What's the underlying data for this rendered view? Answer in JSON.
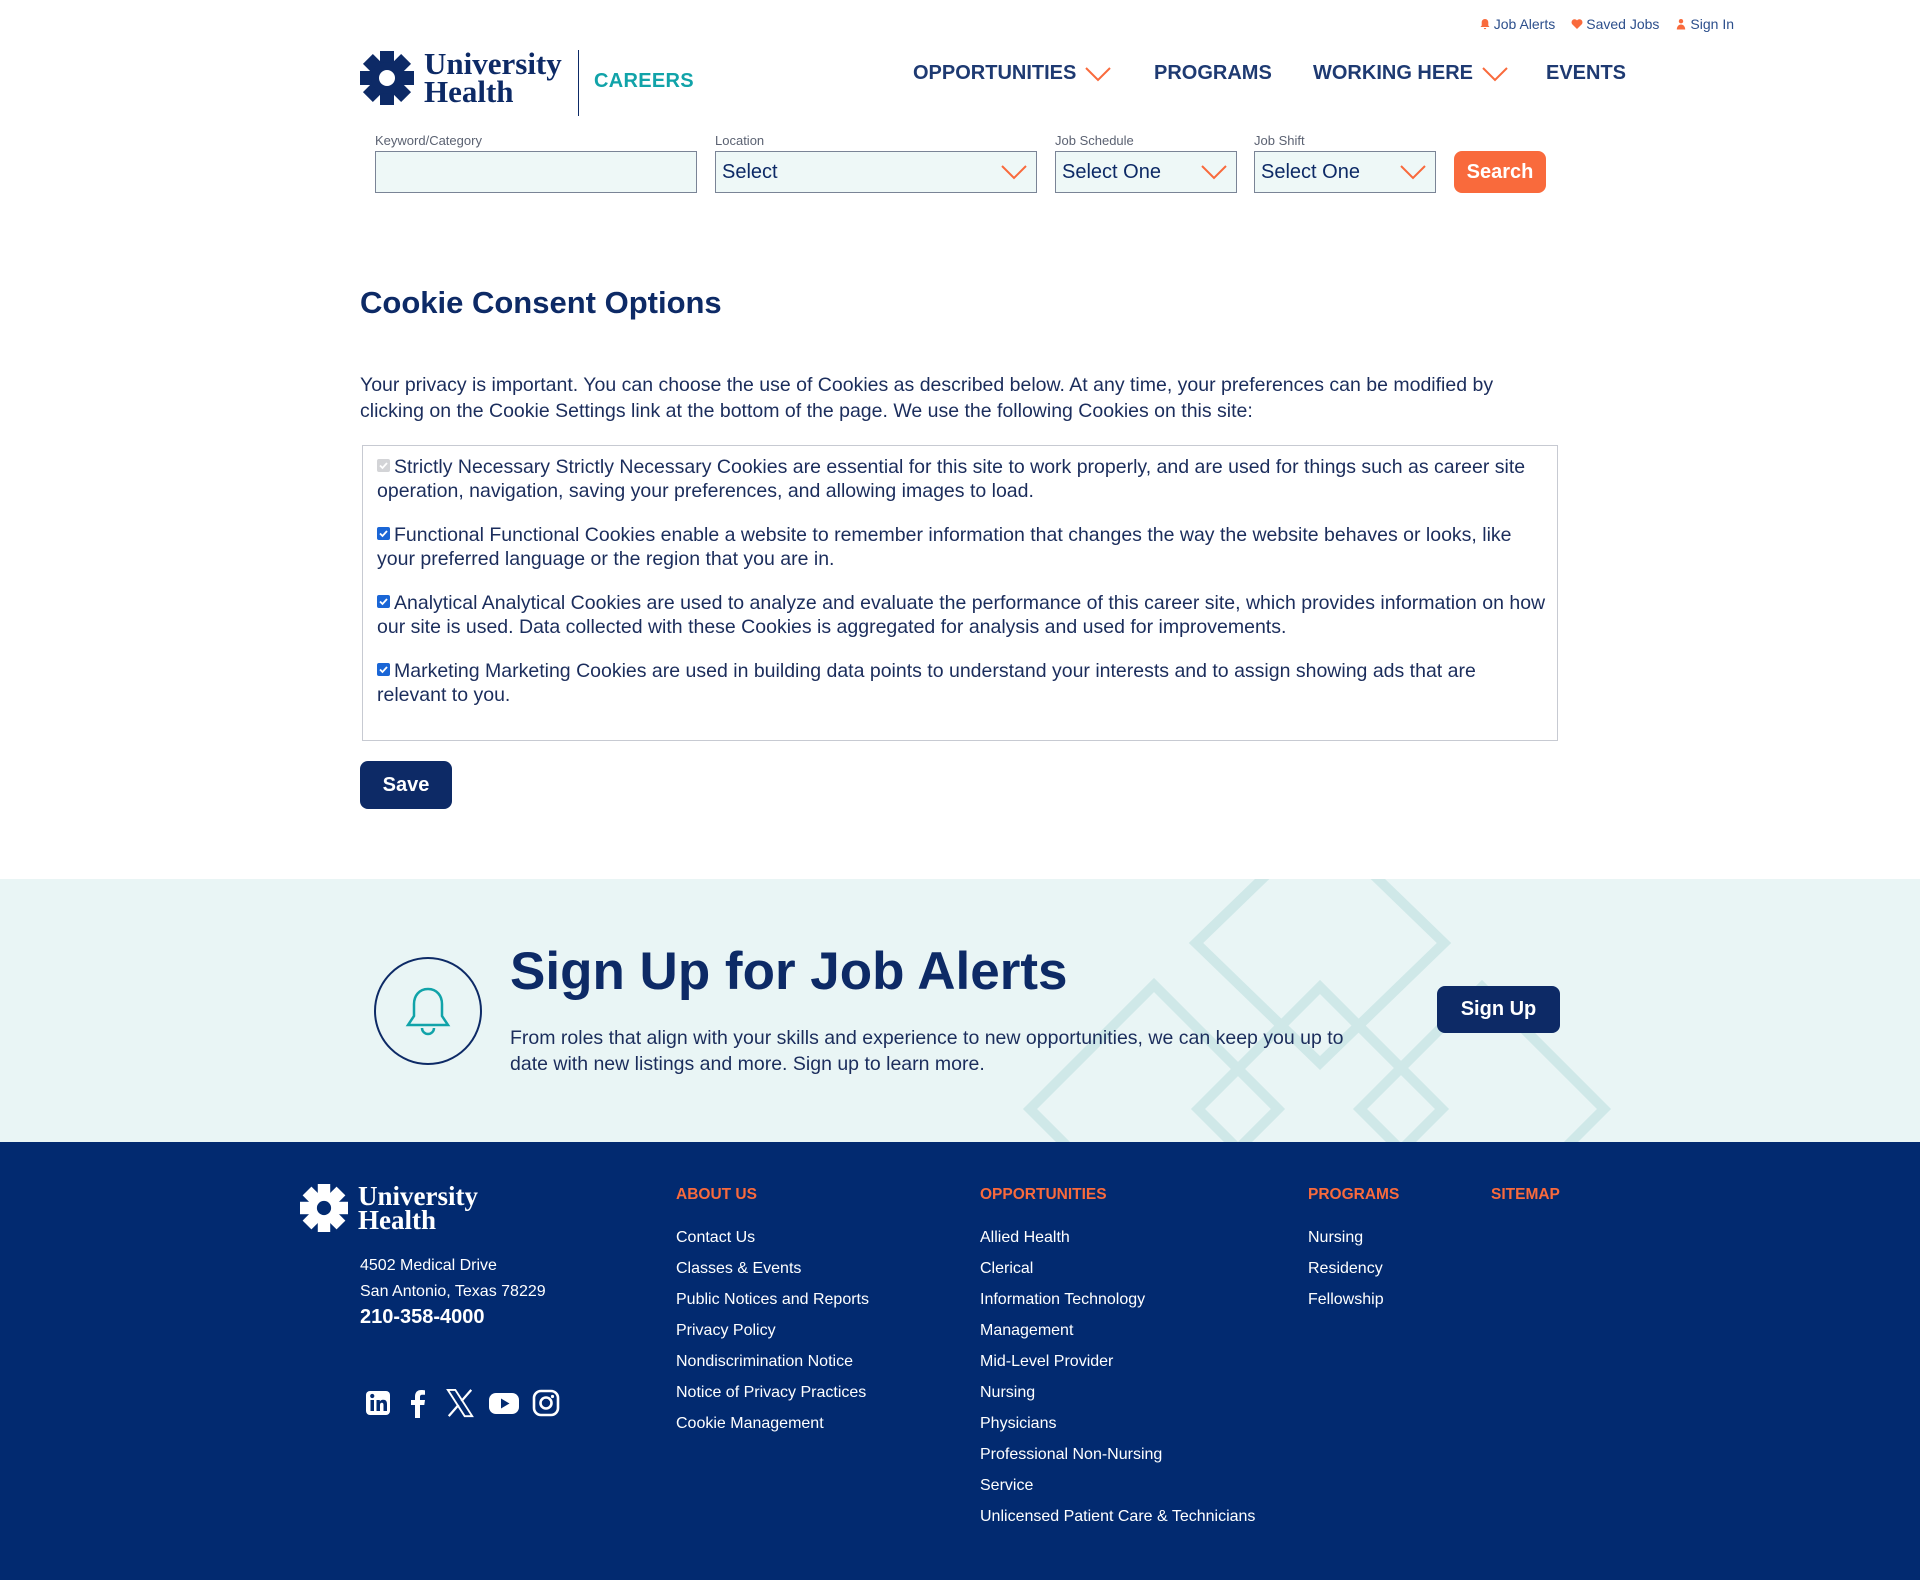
{
  "utility": {
    "job_alerts": "Job Alerts",
    "saved_jobs": "Saved Jobs",
    "sign_in": "Sign In"
  },
  "brand": {
    "logo_line1": "University",
    "logo_line2": "Health",
    "careers": "CAREERS",
    "navy": "#0d2a66",
    "teal": "#11a3a9",
    "orange": "#f96a3c"
  },
  "nav": {
    "opportunities": "OPPORTUNITIES",
    "programs": "PROGRAMS",
    "working_here": "WORKING HERE",
    "events": "EVENTS"
  },
  "search": {
    "keyword_label": "Keyword/Category",
    "keyword_value": "",
    "location_label": "Location",
    "location_value": "Select",
    "schedule_label": "Job Schedule",
    "schedule_value": "Select One",
    "shift_label": "Job Shift",
    "shift_value": "Select One",
    "button": "Search"
  },
  "consent": {
    "title": "Cookie Consent Options",
    "intro": "Your privacy is important. You can choose the use of Cookies as described below. At any time, your preferences can be modified by clicking on the Cookie Settings link at the bottom of the page. We use the following Cookies on this site:",
    "items": [
      {
        "text": "Strictly Necessary Strictly Necessary Cookies are essential for this site to work properly, and are used for things such as career site operation, navigation, saving your preferences, and allowing images to load.",
        "checked": true,
        "disabled": true
      },
      {
        "text": "Functional Functional Cookies enable a website to remember information that changes the way the website behaves or looks, like your preferred language or the region that you are in.",
        "checked": true,
        "disabled": false
      },
      {
        "text": "Analytical Analytical Cookies are used to analyze and evaluate the performance of this career site, which provides information on how our site is used. Data collected with these Cookies is aggregated for analysis and used for improvements.",
        "checked": true,
        "disabled": false
      },
      {
        "text": "Marketing Marketing Cookies are used in building data points to understand your interests and to assign showing ads that are relevant to you.",
        "checked": true,
        "disabled": false
      }
    ],
    "save": "Save"
  },
  "alerts": {
    "title": "Sign Up for Job Alerts",
    "text": "From roles that align with your skills and experience to new opportunities, we can keep you up to date with new listings and more. Sign up to learn more.",
    "button": "Sign Up"
  },
  "footer": {
    "address1": "4502 Medical Drive",
    "address2": "San Antonio, Texas 78229",
    "phone": "210-358-4000",
    "social": [
      "linkedin-icon",
      "facebook-icon",
      "x-icon",
      "youtube-icon",
      "instagram-icon"
    ],
    "about_heading": "ABOUT US",
    "about": [
      "Contact Us",
      "Classes & Events",
      "Public Notices and Reports",
      "Privacy Policy",
      "Nondiscrimination Notice",
      "Notice of Privacy Practices",
      "Cookie Management"
    ],
    "opps_heading": "OPPORTUNITIES",
    "opps": [
      "Allied Health",
      "Clerical",
      "Information Technology",
      "Management",
      "Mid-Level Provider",
      "Nursing",
      "Physicians",
      "Professional Non-Nursing",
      "Service",
      "Unlicensed Patient Care & Technicians"
    ],
    "programs_heading": "PROGRAMS",
    "programs": [
      "Nursing",
      "Residency",
      "Fellowship"
    ],
    "sitemap_heading": "SITEMAP"
  }
}
